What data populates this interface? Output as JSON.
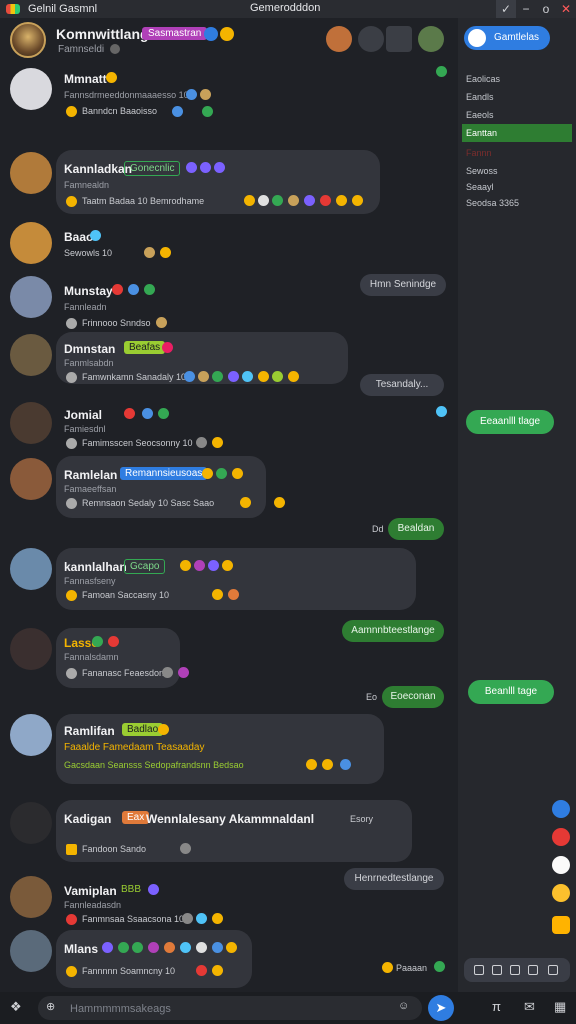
{
  "window": {
    "app_title": "Gelnil Gasmnl",
    "title": "Gemerodddon",
    "controls": [
      "✓",
      "−",
      "o",
      "✕"
    ]
  },
  "header": {
    "group_name": "Komnwittlang",
    "group_tag": "Sasmastran",
    "subtitle": "Famnseldi"
  },
  "messages": [
    {
      "name": "Mmnatt",
      "sub": "Fannsdrmeeddonmaaaesso 10",
      "meta": "Banndcn Baaoisso"
    },
    {
      "name": "Kannladkan",
      "badge": "Gonecnlic",
      "sub": "Famnealdn",
      "meta": "Taatm  Badaa 10  Bemrodhame"
    },
    {
      "name": "Baao",
      "meta": "Sewowls 10"
    },
    {
      "name": "Munstay",
      "sub": "Fannleadn",
      "meta": "Frinnooo  Snndso"
    },
    {
      "name": "Dmnstan",
      "badge": "Beafas",
      "sub": "Fanmlsabdn",
      "meta": "Famwnkamn  Sanadaly  10"
    },
    {
      "name": "Jomial",
      "sub": "Famiesdnl",
      "meta": "Famimsscen  Seocsonny  10"
    },
    {
      "name": "Ramlelan",
      "badge": "Remannsieusoas",
      "sub": "Famaeeffsan",
      "meta": "Remnsaon  Sedaly  10  Sasc Saao"
    },
    {
      "name": "kannlalhan",
      "badge": "Gcapo",
      "sub": "Fannasfseny",
      "meta": "Famoan  Saccasny 10"
    },
    {
      "name": "Lasso",
      "sub": "Fannalsdamn",
      "meta": "Fananasc  Feaesdon"
    },
    {
      "name": "Ramlifan",
      "badge": "Badlao",
      "line2": "Faaalde  Famedaam  Teasaaday",
      "meta": "Gacsdaan  Seansss  Sedopafrandsnn  Bedsao"
    },
    {
      "name": "Kadigan",
      "badge": "Eax",
      "line_rest": "Wennlalesany Akammnaldanl",
      "extra": "Esory",
      "meta": "Fandoon  Sando"
    },
    {
      "name": "Vamiplan",
      "badge": "BBB",
      "sub": "Fannleadasdn",
      "meta": "Fanmnsaa  Ssaacsona  10"
    },
    {
      "name": "Mlans",
      "meta": "Fannnnn  Soamncny  10"
    }
  ],
  "right_pills": [
    {
      "text": "Hmn Senindge",
      "style": "grey"
    },
    {
      "text": "Tesandaly...",
      "style": "grey"
    },
    {
      "text": "Bealdan",
      "style": "green",
      "prefix": "Dd"
    },
    {
      "text": "Aamnnbteestlange",
      "style": "green"
    },
    {
      "text": "Eoeconan",
      "style": "green",
      "prefix": "Eo"
    },
    {
      "text": "Henrnedtestlange",
      "style": "grey"
    },
    {
      "text": "Paaaan",
      "style": "plain"
    }
  ],
  "sidebar": {
    "button_label": "Gamtlelas",
    "menu": [
      "Eaolicas",
      "Eandls",
      "Eaeols",
      "Eanttan",
      "Fannn",
      "Sewoss",
      "Seaayl",
      "Seodsa 3365"
    ],
    "active_index": 3,
    "green_buttons": [
      "Eeaanlll tlage",
      "Beanlll tage"
    ],
    "status_colors": [
      "#2f7de1",
      "#e53935",
      "#fafafa",
      "#fbc02d",
      "#ffb300"
    ]
  },
  "composer": {
    "placeholder": "Hammmmmsakeags"
  },
  "colors": {
    "accent": "#2f7de1",
    "online": "#34a853",
    "bubble": "#33353c",
    "tag_purple": "#b040b8"
  }
}
